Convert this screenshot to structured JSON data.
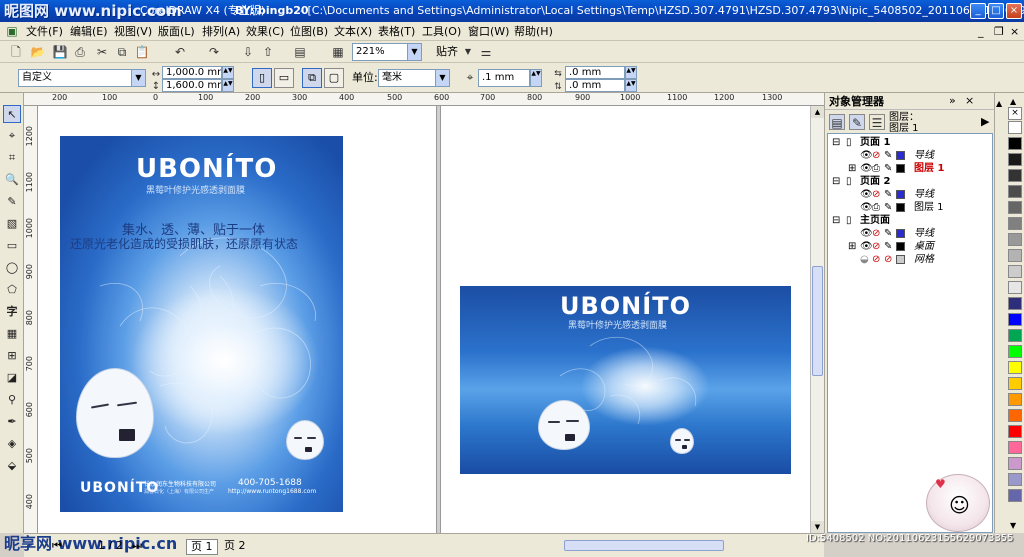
{
  "watermark_top": "昵图网 www.nipic.com",
  "watermark_bottom": "昵享网 www.nipic.cn",
  "titlebar": {
    "app_title": "CorelDRAW X4 (专业版)",
    "author": "BY: bingb20",
    "path": "- [C:\\Documents and Settings\\Administrator\\Local Settings\\Temp\\HZSD.307.4791\\HZSD.307.4793\\Nipic_5408502_20110623155629073355.cdr]"
  },
  "menu": [
    "文件(F)",
    "编辑(E)",
    "视图(V)",
    "版面(L)",
    "排列(A)",
    "效果(C)",
    "位图(B)",
    "文本(X)",
    "表格(T)",
    "工具(O)",
    "窗口(W)",
    "帮助(H)"
  ],
  "toolbar": {
    "zoom": "221%",
    "snap_label": "贴齐"
  },
  "property_bar": {
    "page_preset": "自定义",
    "width": "1,000.0 mm",
    "height": "1,600.0 mm",
    "unit_label": "单位:",
    "unit_value": "毫米",
    "nudge": ".1 mm",
    "dup_x": ".0 mm",
    "dup_y": ".0 mm"
  },
  "ruler_h": [
    "200",
    "100",
    "0",
    "100",
    "200",
    "300",
    "400",
    "500",
    "600",
    "700",
    "800",
    "900",
    "1000",
    "1100",
    "1200",
    "1300",
    "1400",
    "1500",
    "1600",
    "1700"
  ],
  "ruler_v": [
    "1200",
    "1100",
    "1000",
    "900",
    "800",
    "700",
    "600",
    "500",
    "400"
  ],
  "page1": {
    "brand": "UBONÍTO",
    "tagline": "黑莓叶修护光感透剥面膜",
    "headline1": "集水、透、薄、贴于一体",
    "headline2": "还原光老化造成的受损肌肤，还原原有状态",
    "footer_brand": "UBONÍTO",
    "company1": "长沙润东生物科技有限公司",
    "company2": "润普日化（上海）有限公司生产",
    "phone": "400-705-1688",
    "url": "http://www.runtong1688.com"
  },
  "page2": {
    "brand": "UBONÍTO",
    "tagline": "黑莓叶修护光感透剥面膜"
  },
  "dock": {
    "title": "对象管理器",
    "layer_label": "图层：",
    "layer_value": "图层 1",
    "rows": [
      {
        "kind": "page",
        "label": "页面 1"
      },
      {
        "kind": "layer",
        "label": "导线",
        "color": "#2a2bd0"
      },
      {
        "kind": "layer",
        "label": "图层 1",
        "color": "#cc0000",
        "active": true
      },
      {
        "kind": "page",
        "label": "页面 2"
      },
      {
        "kind": "layer",
        "label": "导线",
        "color": "#2a2bd0"
      },
      {
        "kind": "layer",
        "label": "图层 1",
        "color": "#000000"
      },
      {
        "kind": "page",
        "label": "主页面"
      },
      {
        "kind": "layer",
        "label": "导线",
        "color": "#2a2bd0"
      },
      {
        "kind": "layer",
        "label": "桌面",
        "color": "#000000"
      },
      {
        "kind": "layer",
        "label": "网格",
        "color": "#000000"
      }
    ]
  },
  "palette_colors": [
    "#ffffff",
    "#000000",
    "#1a1a1a",
    "#333333",
    "#4d4d4d",
    "#666666",
    "#808080",
    "#999999",
    "#b3b3b3",
    "#cccccc",
    "#e6e6e6",
    "#2e2e7a",
    "#0000ff",
    "#00a651",
    "#00ff00",
    "#ffff00",
    "#ffcc00",
    "#ff9900",
    "#ff6600",
    "#ff0000",
    "#ff6699",
    "#cc99cc",
    "#9999cc",
    "#6666aa"
  ],
  "status": {
    "page_count": "1 / 2",
    "page1_tab": "页 1",
    "page2_tab": "页 2",
    "image_id": "ID:5408502 NO:20110623155629073355"
  }
}
